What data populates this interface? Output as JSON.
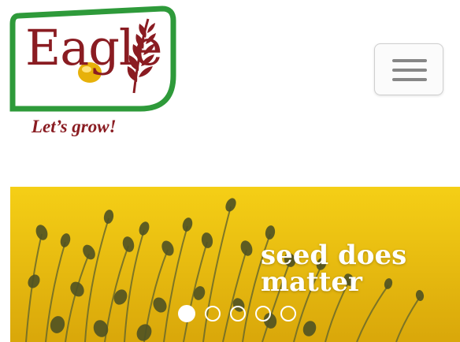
{
  "header": {
    "logo": {
      "brand": "Eagle",
      "tagline": "Let’s grow!"
    },
    "menu_toggle": {
      "icon": "hamburger-menu-icon"
    }
  },
  "carousel": {
    "image": "seed-sprouts-photo",
    "caption_lines": [
      "seed does",
      "matter"
    ],
    "indicators": {
      "count": 5,
      "active_index": 0
    }
  },
  "colors": {
    "brand_maroon": "#8a1c22",
    "logo_green": "#2e9a3a",
    "banner_yellow": "#f1c40f"
  }
}
